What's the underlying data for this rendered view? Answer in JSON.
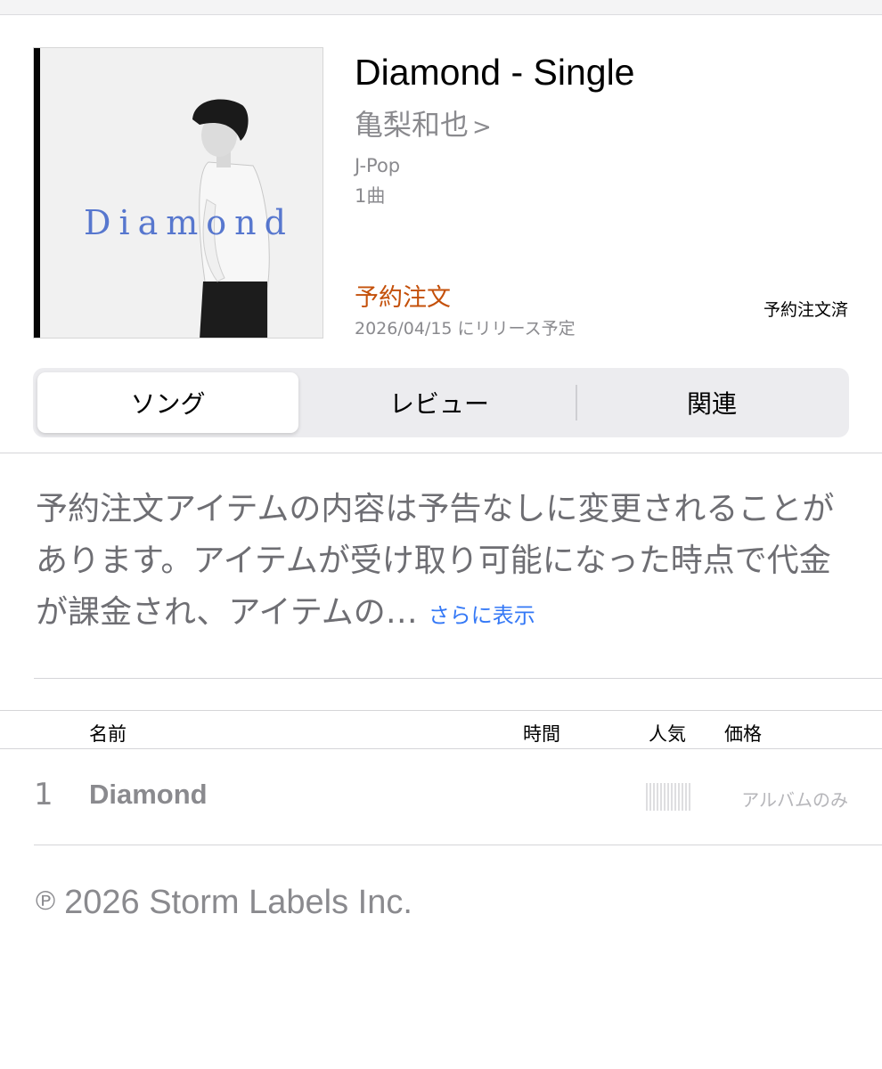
{
  "album": {
    "title": "Diamond - Single",
    "artist": "亀梨和也",
    "artist_chevron": ">",
    "genre": "J-Pop",
    "track_count": "1曲",
    "artwork_text": "Diamond",
    "preorder_label": "予約注文",
    "release_note": "2026/04/15 にリリース予定",
    "ordered_status": "予約注文済"
  },
  "tabs": [
    {
      "label": "ソング",
      "selected": true
    },
    {
      "label": "レビュー",
      "selected": false
    },
    {
      "label": "関連",
      "selected": false
    }
  ],
  "description": {
    "text": "予約注文アイテムの内容は予告なしに変更されることがあります。アイテムが受け取り可能になった時点で代金が課金され、アイテムの…",
    "more_link": "さらに表示"
  },
  "track_table": {
    "headers": {
      "name": "名前",
      "time": "時間",
      "popularity": "人気",
      "price": "価格"
    },
    "rows": [
      {
        "number": "1",
        "title": "Diamond",
        "time": "",
        "price": "アルバムのみ"
      }
    ]
  },
  "footer": {
    "copyright_symbol": "℗",
    "copyright": "2026 Storm Labels Inc."
  },
  "colors": {
    "accent_orange": "#c4500a",
    "link_blue": "#3478f6",
    "secondary_gray": "#8a8a8e",
    "artwork_text_blue": "#3d62c9"
  }
}
